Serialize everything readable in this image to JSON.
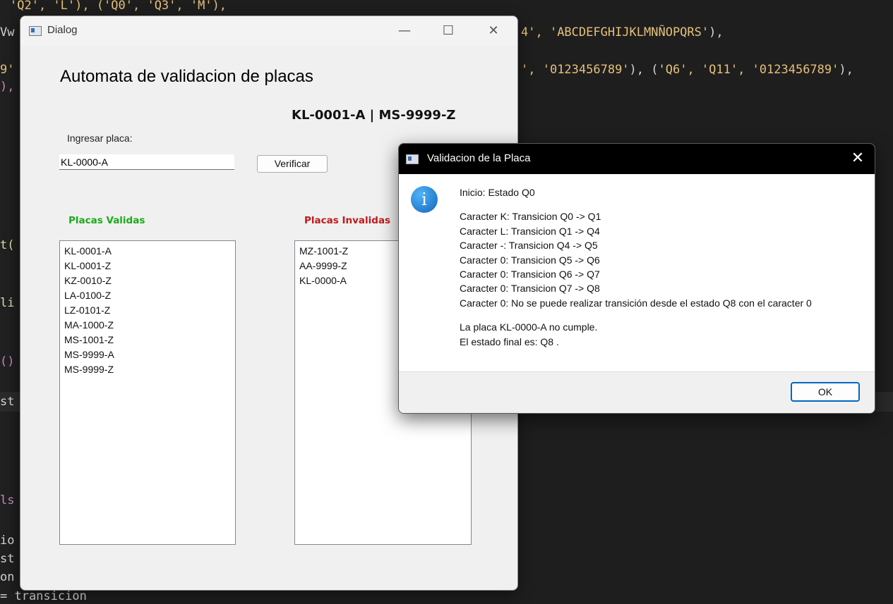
{
  "editor": {
    "line1": [
      "'Q2', 'L'), ('Q0', 'Q3', 'M'),"
    ],
    "line2_left": "Vw",
    "line2_right_pre": "4', ",
    "line2_right_str": "'ABCDEFGHIJKLMNÑOPQRS'",
    "line2_right_post": "),",
    "line3_left": "9'",
    "line3_right_a": "', ",
    "line3_right_s1": "'0123456789'",
    "line3_right_b": "), ('",
    "line3_right_s2": "Q6', 'Q11', '0123456789'",
    "line3_right_c": "),",
    "line4_left": "),",
    "frag_t": "t(",
    "frag_li": "li",
    "frag_paren": "()",
    "frag_st": "st",
    "frag_ls": "ls",
    "frag_io": "io",
    "frag_st2": "st",
    "frag_on": "on",
    "last_line": "= transicion"
  },
  "dialog": {
    "window_title": "Dialog",
    "heading": "Automata de validacion de placas",
    "format": "KL-0001-A | MS-9999-Z",
    "input_label": "Ingresar  placa:",
    "input_value": "KL-0000-A",
    "verify_label": "Verificar",
    "valid_label": "Placas Validas",
    "invalid_label": "Placas Invalidas",
    "valid_plates": [
      "KL-0001-A",
      "KL-0001-Z",
      "KZ-0010-Z",
      "LA-0100-Z",
      "LZ-0101-Z",
      "MA-1000-Z",
      "MS-1001-Z",
      "MS-9999-A",
      "MS-9999-Z"
    ],
    "invalid_plates": [
      "MZ-1001-Z",
      "AA-9999-Z",
      "KL-0000-A"
    ]
  },
  "msgbox": {
    "title": "Validacion de la Placa",
    "icon": "info-icon",
    "icon_glyph": "i",
    "lines": {
      "start": "Inicio: Estado Q0",
      "t1": "Caracter K: Transicion Q0 -> Q1",
      "t2": "Caracter L: Transicion Q1 -> Q4",
      "t3": "Caracter -: Transicion Q4 -> Q5",
      "t4": "Caracter 0: Transicion Q5 -> Q6",
      "t5": "Caracter 0: Transicion Q6 -> Q7",
      "t6": "Caracter 0: Transicion Q7 -> Q8",
      "t7": "Caracter 0: No se puede realizar transición desde el estado Q8 con el caracter 0",
      "result1": "La placa KL-0000-A no cumple.",
      "result2": "El estado final es: Q8 ."
    },
    "ok_label": "OK"
  },
  "colors": {
    "valid": "#1aaa1a",
    "invalid": "#c01a1a",
    "accent": "#0067c0"
  }
}
